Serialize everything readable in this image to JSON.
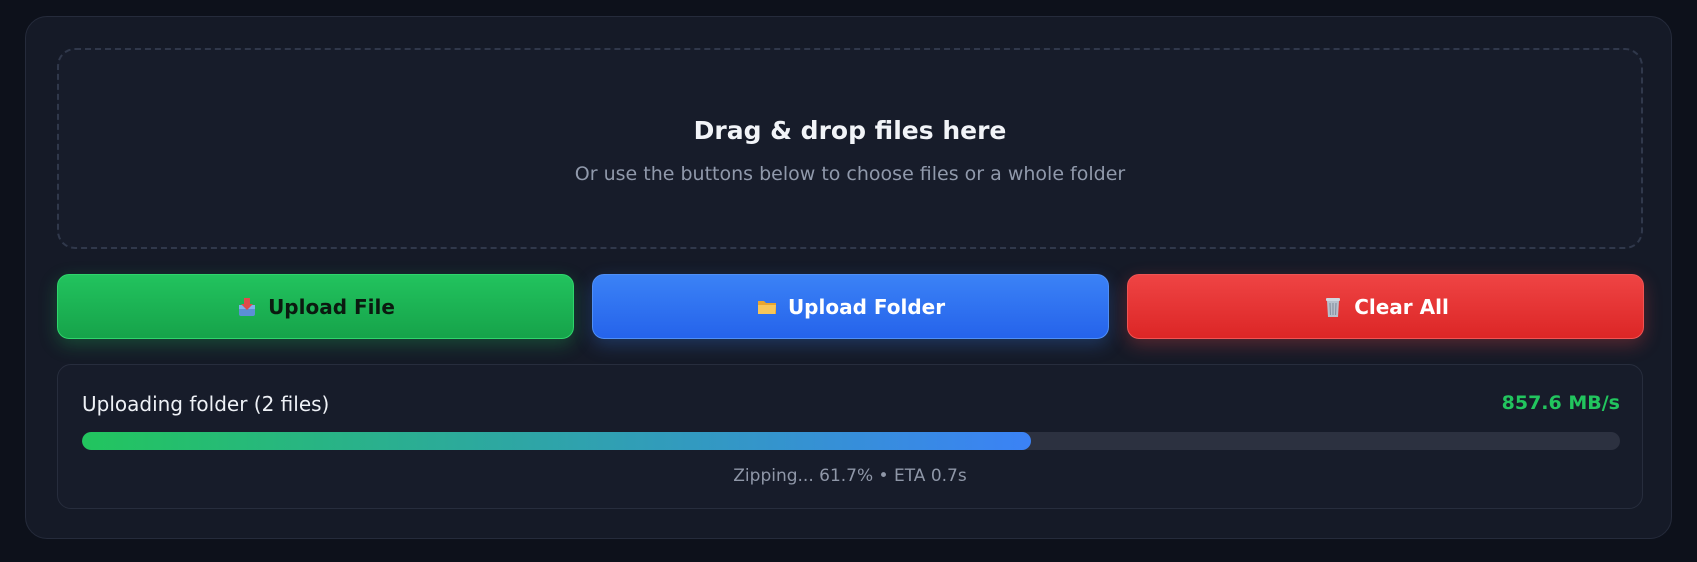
{
  "dropzone": {
    "title": "Drag & drop files here",
    "subtitle": "Or use the buttons below to choose files or a whole folder"
  },
  "buttons": {
    "upload_file": {
      "label": "Upload File",
      "icon": "inbox-tray-icon"
    },
    "upload_folder": {
      "label": "Upload Folder",
      "icon": "folder-icon"
    },
    "clear_all": {
      "label": "Clear All",
      "icon": "wastebasket-icon"
    }
  },
  "progress": {
    "title": "Uploading folder (2 files)",
    "speed": "857.6 MB/s",
    "percent": 61.7,
    "status": "Zipping... 61.7% • ETA 0.7s"
  },
  "colors": {
    "accent_green": "#22c55e",
    "accent_blue": "#3b82f6",
    "accent_red": "#ef4444",
    "background": "#0d111b"
  }
}
